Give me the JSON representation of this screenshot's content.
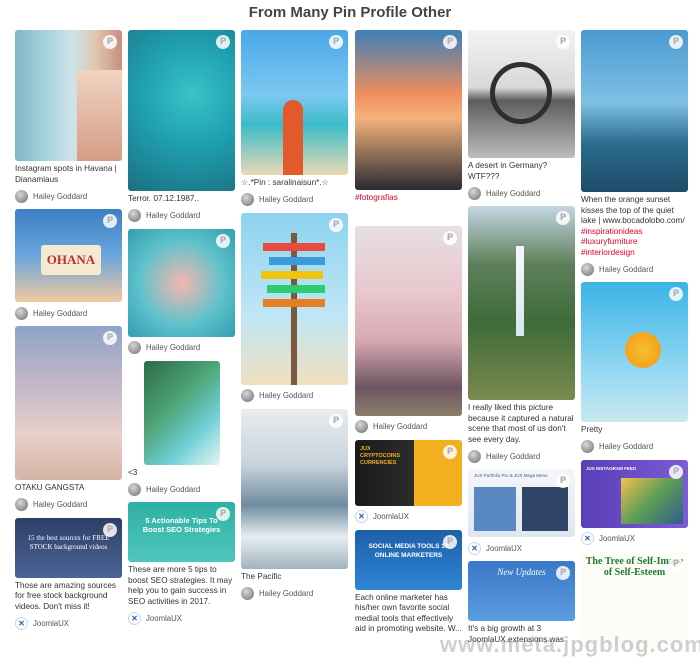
{
  "page": {
    "title": "From Many Pin Profile Other",
    "watermark": "www.meta.jpgblog.com.ua"
  },
  "pin_icon": "P",
  "icon_names": {
    "pin": "pinterest-icon",
    "joomlaux": "joomlaux-logo-icon"
  },
  "columns": [
    {
      "cards": [
        {
          "caption": "Instagram spots in Havana | Dianamiaus",
          "user": "Hailey Goddard"
        },
        {
          "caption": "",
          "overlay": "OHANA",
          "user": "Hailey Goddard"
        },
        {
          "caption": "OTAKU GANGSTA",
          "user": "Hailey Goddard"
        },
        {
          "caption": "Those are amazing sources for free stock background videos. Don't miss it!",
          "overlay": "15 the best sources for FREE STOCK background videos",
          "user": "JoomlaUX"
        }
      ]
    },
    {
      "cards": [
        {
          "caption": "Terror. 07.12.1987..",
          "user": "Hailey Goddard"
        },
        {
          "caption": "",
          "user": "Hailey Goddard"
        },
        {
          "caption": "<3",
          "user": "Hailey Goddard"
        },
        {
          "caption": "These are more 5 tips to boost SEO strategies. It may help you to gain success in SEO activities in 2017.",
          "overlay": "5 Actionable Tips To Boost SEO Strategies",
          "user": "JoomlaUX"
        }
      ]
    },
    {
      "cards": [
        {
          "caption": "☆.*Pin : saralinaisun*.☆",
          "user": "Hailey Goddard"
        },
        {
          "caption": "",
          "user": "Hailey Goddard"
        },
        {
          "caption": "The Pacific",
          "user": "Hailey Goddard"
        }
      ]
    },
    {
      "cards": [
        {
          "caption": "#fotografias",
          "caption_red": true,
          "user": ""
        },
        {
          "caption": "",
          "user": "Hailey Goddard"
        },
        {
          "caption": "",
          "overlay": "JUX CRYPTOCOINS CURRENCIES",
          "user": "JoomlaUX"
        },
        {
          "caption": "Each online marketer has his/her own favorite social medial tools that effectively aid in promoting website. W...",
          "overlay": "SOCIAL MEDIA TOOLS 17 ONLINE MARKETERS",
          "user": ""
        }
      ]
    },
    {
      "cards": [
        {
          "caption": "A desert in Germany? WTF???",
          "user": "Hailey Goddard"
        },
        {
          "caption": "I really liked this picture because it captured a natural scene that most of us don't see every day.",
          "user": "Hailey Goddard"
        },
        {
          "caption": "",
          "overlay": "JUX Portfolio Pro & JUX Mega Menu",
          "user": "JoomlaUX"
        },
        {
          "caption": "It's a big growth at 3 JoomlaUX extensions was",
          "overlay": "New Updates",
          "user": ""
        }
      ]
    },
    {
      "cards": [
        {
          "caption": "When the orange sunset kisses the top of the quiet lake | www.bocadolobo.com/",
          "tags": [
            "#inspirationideas",
            "#luxuryfurniture",
            "#interiordesign"
          ],
          "user": "Hailey Goddard"
        },
        {
          "caption": "Pretty",
          "user": "Hailey Goddard"
        },
        {
          "caption": "",
          "overlay": "JUX INSTAGRAM FEED",
          "user": "JoomlaUX"
        },
        {
          "caption": "",
          "overlay": "The Tree of Self-Image of Self-Esteem",
          "user": ""
        }
      ]
    }
  ],
  "colors": {
    "accent_red": "#e60023",
    "joomlaux_blue": "#1d64c6",
    "title": "#444444"
  }
}
